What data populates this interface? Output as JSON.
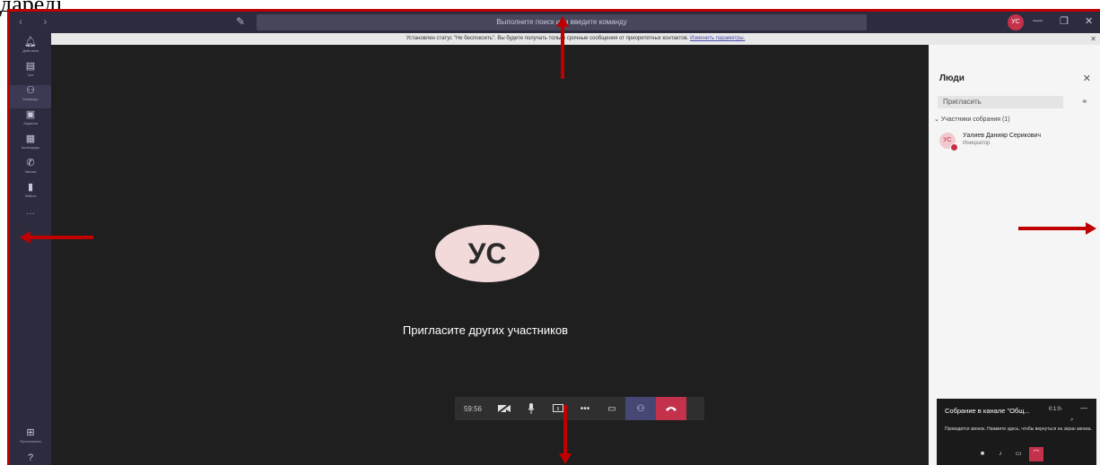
{
  "caption": "дареді.",
  "titlebar": {
    "nav_arrows": "‹  ›",
    "search_placeholder": "Выполните поиск или введите команду",
    "user_initials": "УС",
    "minimize": "—",
    "maximize": "❐",
    "close": "✕"
  },
  "notification": {
    "text": "Установлен статус \"Не беспокоить\". Вы будете получать только срочные сообщения от приоритетных контактов.",
    "link": "Изменить параметры.",
    "close": "✕"
  },
  "rail": {
    "items": [
      {
        "label": "Действия",
        "icon": "bell-icon"
      },
      {
        "label": "Чат",
        "icon": "chat-icon"
      },
      {
        "label": "Команды",
        "icon": "teams-icon"
      },
      {
        "label": "Задания",
        "icon": "assignments-icon"
      },
      {
        "label": "Календарь",
        "icon": "calendar-icon"
      },
      {
        "label": "Звонки",
        "icon": "phone-icon"
      },
      {
        "label": "Файлы",
        "icon": "files-icon"
      }
    ],
    "more": "···",
    "apps_label": "Приложения",
    "help_icon": "?"
  },
  "meeting": {
    "avatar_initials": "УС",
    "invite_message": "Пригласите других участников",
    "timer": "59:56"
  },
  "people_panel": {
    "title": "Люди",
    "close": "✕",
    "invite_placeholder": "Пригласить",
    "section": "Участники собрания (1)",
    "participants": [
      {
        "initials": "УС",
        "name": "Уалиев Данияр Серикович",
        "role": "Инициатор"
      }
    ]
  },
  "mini_window": {
    "title": "Собрание в канале \"Общ...",
    "time": "0:1:0-",
    "minimize": "—",
    "text": "Проводится звонок. Нажмите здесь, чтобы вернуться на экран звонка."
  },
  "colors": {
    "annotation_red": "#c00000",
    "rail_bg": "#2d2c3e",
    "stage_bg": "#1f1f1f",
    "end_call": "#c4314b",
    "people_active": "#464775"
  }
}
